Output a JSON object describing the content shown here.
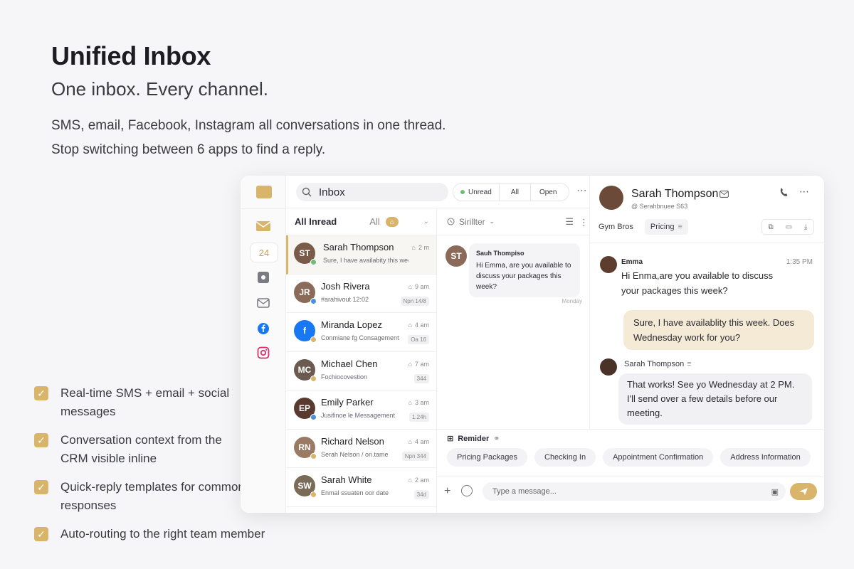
{
  "hero": {
    "title": "Unified Inbox",
    "subtitle": "One inbox. Every channel.",
    "desc_line1": "SMS, email, Facebook, Instagram all conversations in one thread.",
    "desc_line2": "Stop switching between 6 apps to find a reply."
  },
  "features": [
    "Real-time SMS + email + social messages",
    "Conversation context from the CRM visible inline",
    "Quick-reply templates for common responses",
    "Auto-routing to the right team member"
  ],
  "colors": {
    "accent": "#d9b46b",
    "accent_soft": "#f4ead6",
    "unread_dot": "#6cbf72"
  },
  "rail": {
    "calendar_badge": "24"
  },
  "topbar": {
    "search_label": "Inbox",
    "filters": [
      "Unread",
      "All",
      "Open"
    ]
  },
  "list": {
    "header_all_unread": "All Inread",
    "header_all": "All",
    "items": [
      {
        "name": "Sarah Thompson",
        "time": "2 m",
        "preview": "Sure, I have availabity this week...",
        "tag": "",
        "initials": "ST",
        "color": "#7a5a48",
        "badge": "#6cbf72"
      },
      {
        "name": "Josh Rivera",
        "time": "9 am",
        "preview": "#arahivout 12:02",
        "tag": "Npn 14/8",
        "initials": "JR",
        "color": "#8a6a58",
        "badge": "#4a90d9"
      },
      {
        "name": "Miranda Lopez",
        "time": "4 am",
        "preview": "Conmiane fg Consagement",
        "tag": "Oa 16",
        "initials": "f",
        "color": "#1877f2",
        "badge": "#d9b46b"
      },
      {
        "name": "Michael Chen",
        "time": "7 am",
        "preview": "Fochiocovestion",
        "tag": "344",
        "initials": "MC",
        "color": "#6a5a50",
        "badge": "#d9b46b"
      },
      {
        "name": "Emily Parker",
        "time": "3 am",
        "preview": "Jusifinoe le Messagement",
        "tag": "1.24h",
        "initials": "EP",
        "color": "#5a3a30",
        "badge": "#4a90d9"
      },
      {
        "name": "Richard Nelson",
        "time": "4 am",
        "preview": "Serah Nelson / on.tame",
        "tag": "Npn 344",
        "initials": "RN",
        "color": "#9a7a62",
        "badge": "#d9b46b"
      },
      {
        "name": "Sarah White",
        "time": "2 am",
        "preview": "Enmal ssuaten oor date",
        "tag": "34d",
        "initials": "SW",
        "color": "#7a6a58",
        "badge": "#d9b46b"
      }
    ]
  },
  "thread": {
    "header": "Sirillter",
    "sender": "Sauh Thompiso",
    "text": "Hi Emma, are you available to discuss your packages this week?",
    "day": "Monday"
  },
  "contact": {
    "name": "Sarah Thompson",
    "sub": "@ Serahbnuee S63",
    "tags": [
      "Gym Bros",
      "Pricing"
    ],
    "messages": {
      "emma_name": "Emma",
      "emma_time": "1:35 PM",
      "emma_text": "Hi Enma,are you available to discuss your packages this week?",
      "reply_text": "Sure, I have availablity this week. Does Wednesday work for you?",
      "st_name": "Sarah Thompson",
      "st_text": "That works! See yo Wednesday at 2 PM. I'll send over a few details before our meeting."
    }
  },
  "composer": {
    "reminder_label": "Remider",
    "templates": [
      "Pricing Packages",
      "Checking In",
      "Appointment Confirmation",
      "Address Information"
    ],
    "placeholder": "Type a message..."
  }
}
